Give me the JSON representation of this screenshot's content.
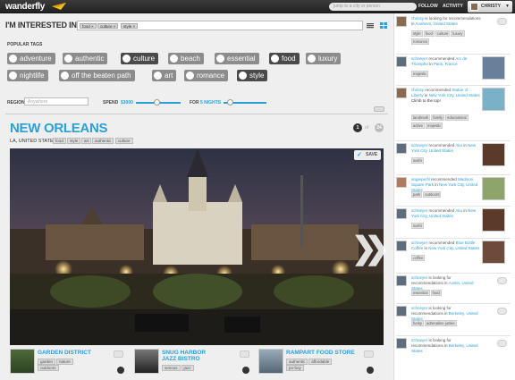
{
  "header": {
    "logo": "wanderfly",
    "search_placeholder": "jump to a city or person",
    "nav_follow": "FOLLOW",
    "nav_activity": "ACTIVITY",
    "user_name": "CHRISTY"
  },
  "interests": {
    "title": "I'M INTERESTED IN",
    "chips": [
      "food",
      "culture",
      "style"
    ]
  },
  "popular": {
    "title": "POPULAR TAGS",
    "tags": [
      "adventure",
      "authentic",
      "culture",
      "beach",
      "essential",
      "food",
      "luxury",
      "nightlife",
      "off the beaten path",
      "art",
      "romance",
      "style"
    ],
    "selected": [
      "culture",
      "food",
      "style"
    ]
  },
  "filters": {
    "region_label": "REGION",
    "region_placeholder": "Anywhere",
    "spend_label": "SPEND",
    "spend_value": "$3000",
    "for_label": "FOR",
    "for_value": "5 NIGHTS",
    "spend_level": 0.45,
    "nights_level": 0.15
  },
  "destination": {
    "city": "NEW ORLEANS",
    "location": "LA, UNITED STATES",
    "tags": [
      "food",
      "style",
      "art",
      "authentic",
      "culture"
    ],
    "page_current": "1",
    "page_of": "of",
    "page_total": "24",
    "save_label": "SAVE",
    "next_arrow": "❯❯"
  },
  "places": [
    {
      "name": "GARDEN DISTRICT",
      "tags": [
        "garden",
        "nature",
        "outdoors"
      ]
    },
    {
      "name": "SNUG HARBOR JAZZ BISTRO",
      "tags": [
        "serious",
        "jazz"
      ]
    },
    {
      "name": "RAMPART FOOD STORE",
      "tags": [
        "authentic",
        "affordable",
        "po-boy"
      ]
    }
  ],
  "feed": [
    {
      "user": "chrissy",
      "pre": "is looking for recommendations in",
      "target": "Anaheim, United States",
      "post": "",
      "tags": [
        "style",
        "food",
        "culture",
        "luxury",
        "romance"
      ],
      "kind": "request"
    },
    {
      "user": "schneyer",
      "pre": "recommended",
      "target": "Arc de Triomphe",
      "post": "in",
      "place": "Paris, France",
      "tags": [
        "majestic"
      ],
      "kind": "rec"
    },
    {
      "user": "chrissy",
      "pre": "recommended",
      "target": "Statue of Liberty",
      "post": "in",
      "place": "New York City, United States",
      "note": "Climb to the top!",
      "tags": [
        "landmark",
        "family",
        "educational",
        "active",
        "majestic"
      ],
      "kind": "rec"
    },
    {
      "user": "schneyer",
      "pre": "recommended",
      "target": "Ako",
      "post": "in",
      "place": "New York City, United States",
      "tags": [
        "sushi"
      ],
      "kind": "rec"
    },
    {
      "user": "angieperfil",
      "pre": "recommended",
      "target": "Madison Square Park",
      "post": "in",
      "place": "New York City, United States",
      "tags": [
        "park",
        "outdoors"
      ],
      "kind": "rec"
    },
    {
      "user": "schneyer",
      "pre": "recommended",
      "target": "Ako",
      "post": "in",
      "place": "New York City, United States",
      "tags": [
        "sushi"
      ],
      "kind": "rec"
    },
    {
      "user": "schneyer",
      "pre": "recommended",
      "target": "Blue Bottle Coffee",
      "post": "in",
      "place": "New York City, United States",
      "tags": [
        "coffee"
      ],
      "kind": "rec"
    },
    {
      "user": "schneyer",
      "pre": "is looking for recommendations in",
      "target": "Austin, United States",
      "post": "",
      "tags": [
        "essential",
        "food"
      ],
      "kind": "request"
    },
    {
      "user": "schneyer",
      "pre": "is looking for recommendations in",
      "target": "Berkeley, United States",
      "post": "",
      "tags": [
        "funky",
        "adrenaline junkie"
      ],
      "kind": "request"
    },
    {
      "user": "schneyer",
      "pre": "is looking for recommendations in",
      "target": "Berkeley, United States",
      "post": "",
      "tags": [],
      "kind": "request"
    }
  ],
  "colors": {
    "accent": "#2aa0d8",
    "tag_bg": "#8c8c8c",
    "tag_selected": "#4a4a4a",
    "header_bg": "#2b2b2b"
  }
}
